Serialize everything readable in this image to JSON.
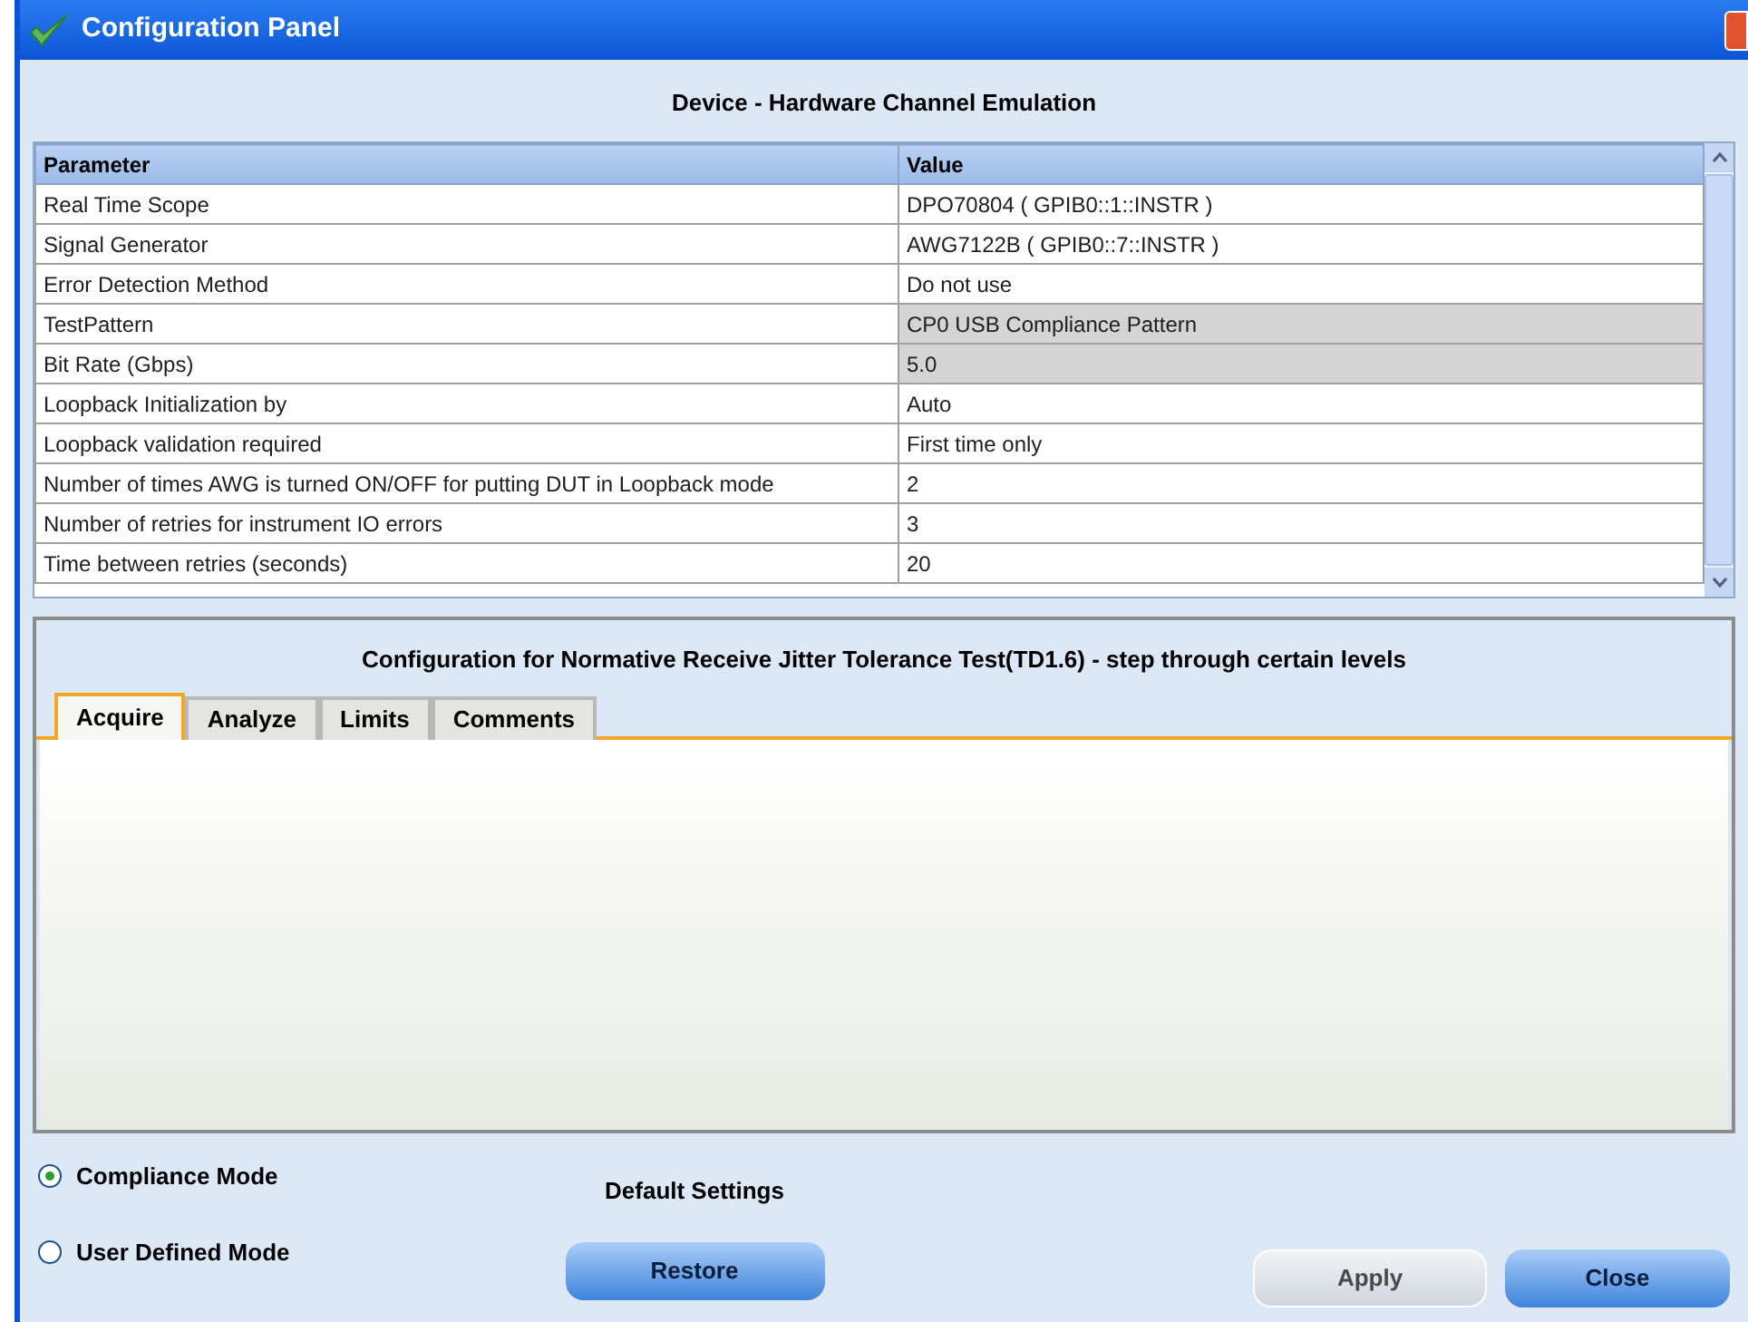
{
  "window": {
    "title": "Configuration Panel"
  },
  "device_section": {
    "title": "Device - Hardware Channel Emulation"
  },
  "table": {
    "columns": [
      "Parameter",
      "Value"
    ],
    "rows": [
      {
        "parameter": "Real Time Scope",
        "value": "DPO70804 ( GPIB0::1::INSTR )",
        "readonly": false
      },
      {
        "parameter": "Signal Generator",
        "value": "AWG7122B ( GPIB0::7::INSTR )",
        "readonly": false
      },
      {
        "parameter": "Error Detection Method",
        "value": "Do not use",
        "readonly": false
      },
      {
        "parameter": "TestPattern",
        "value": "CP0 USB Compliance Pattern",
        "readonly": true
      },
      {
        "parameter": "Bit Rate (Gbps)",
        "value": "5.0",
        "readonly": true
      },
      {
        "parameter": "Loopback Initialization by",
        "value": "Auto",
        "readonly": false
      },
      {
        "parameter": "Loopback validation required",
        "value": "First time only",
        "readonly": false
      },
      {
        "parameter": "Number of times AWG is turned ON/OFF for putting DUT in Loopback mode",
        "value": "2",
        "readonly": false
      },
      {
        "parameter": "Number of retries for instrument IO errors",
        "value": "3",
        "readonly": false
      },
      {
        "parameter": "Time between retries (seconds)",
        "value": "20",
        "readonly": false
      }
    ]
  },
  "config_section": {
    "title": "Configuration for Normative Receive Jitter Tolerance Test(TD1.6) - step through certain levels",
    "tabs": [
      {
        "label": "Acquire",
        "selected": true
      },
      {
        "label": "Analyze",
        "selected": false
      },
      {
        "label": "Limits",
        "selected": false
      },
      {
        "label": "Comments",
        "selected": false
      }
    ]
  },
  "modes": [
    {
      "label": "Compliance Mode",
      "selected": true
    },
    {
      "label": "User Defined Mode",
      "selected": false
    }
  ],
  "default_settings": {
    "label": "Default Settings",
    "button": "Restore"
  },
  "buttons": [
    {
      "label": "Apply",
      "disabled": true
    },
    {
      "label": "Close",
      "disabled": false
    }
  ]
}
